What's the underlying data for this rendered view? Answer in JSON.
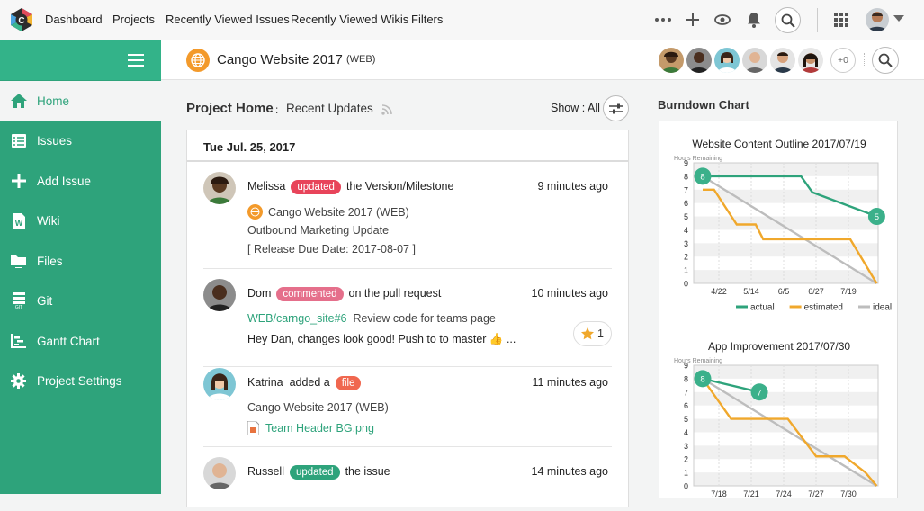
{
  "topnav": {
    "items": [
      "Dashboard",
      "Projects",
      "Recently Viewed Issues",
      "Recently Viewed Wikis",
      "Filters"
    ]
  },
  "sidebar": {
    "items": [
      {
        "label": "Home",
        "icon": "home-icon"
      },
      {
        "label": "Issues",
        "icon": "issues-icon"
      },
      {
        "label": "Add Issue",
        "icon": "plus-icon"
      },
      {
        "label": "Wiki",
        "icon": "wiki-icon"
      },
      {
        "label": "Files",
        "icon": "files-icon"
      },
      {
        "label": "Git",
        "icon": "git-icon"
      },
      {
        "label": "Gantt Chart",
        "icon": "gantt-icon"
      },
      {
        "label": "Project Settings",
        "icon": "gear-icon"
      }
    ]
  },
  "project": {
    "name": "Cango Website 2017",
    "tag": "(WEB)",
    "more_members": "+0"
  },
  "main": {
    "title": "Project Home",
    "subtitle": "Recent Updates",
    "show_label": "Show : All"
  },
  "feed": {
    "date": "Tue Jul. 25, 2017",
    "entries": [
      {
        "user": "Melissa",
        "action": "updated",
        "action_color": "#e8445a",
        "text": "the Version/Milestone",
        "time": "9 minutes ago",
        "project": "Cango Website 2017 (WEB)",
        "detail1": "Outbound Marketing Update",
        "detail2": "[ Release Due Date: 2017-08-07 ]"
      },
      {
        "user": "Dom",
        "action": "commented",
        "action_color": "#e56f8b",
        "text": "on the pull request",
        "time": "10 minutes ago",
        "link": "WEB/carngo_site#6",
        "link_text": "Review code for teams page",
        "message": "Hey Dan, changes look good! Push to to master 👍 ...",
        "likes": "1"
      },
      {
        "user": "Katrina",
        "pre": "added a",
        "action": "file",
        "action_color": "#f0674f",
        "time": "11 minutes ago",
        "project": "Cango Website 2017 (WEB)",
        "file": "Team Header BG.png"
      },
      {
        "user": "Russell",
        "action": "updated",
        "action_color": "#2ea37b",
        "text": "the issue",
        "time": "14 minutes ago"
      }
    ]
  },
  "burndown": {
    "heading": "Burndown Chart"
  },
  "chart_data": [
    {
      "type": "line",
      "title": "Website Content Outline 2017/07/19",
      "ylabel": "Hours Remaining",
      "ylim": [
        0,
        9
      ],
      "x": [
        "4/22",
        "5/14",
        "6/5",
        "6/27",
        "7/19"
      ],
      "series": [
        {
          "name": "actual",
          "color": "#2ea37b",
          "points": [
            [
              0,
              8
            ],
            [
              2.6,
              8
            ],
            [
              2.9,
              6.8
            ],
            [
              4.6,
              5
            ]
          ]
        },
        {
          "name": "estimated",
          "color": "#f0a82c",
          "points": [
            [
              0,
              7
            ],
            [
              0.3,
              7
            ],
            [
              0.9,
              4.4
            ],
            [
              1.4,
              4.4
            ],
            [
              1.6,
              3.3
            ],
            [
              3.9,
              3.3
            ],
            [
              4.6,
              0
            ]
          ]
        },
        {
          "name": "ideal",
          "color": "#bdbdbd",
          "points": [
            [
              0,
              8
            ],
            [
              4.6,
              0
            ]
          ]
        }
      ],
      "labels": [
        {
          "x": 0,
          "y": 8,
          "text": "8"
        },
        {
          "x": 4.6,
          "y": 5,
          "text": "5"
        }
      ],
      "legend": "bottom"
    },
    {
      "type": "line",
      "title": "App Improvement 2017/07/30",
      "ylabel": "Hours Remaining",
      "ylim": [
        0,
        9
      ],
      "x": [
        "7/18",
        "7/21",
        "7/24",
        "7/27",
        "7/30"
      ],
      "series": [
        {
          "name": "actual",
          "color": "#2ea37b",
          "points": [
            [
              0,
              8
            ],
            [
              1.5,
              7
            ]
          ]
        },
        {
          "name": "estimated",
          "color": "#f0a82c",
          "points": [
            [
              0,
              8
            ],
            [
              0.75,
              5
            ],
            [
              2.25,
              5
            ],
            [
              3,
              2.2
            ],
            [
              3.75,
              2.2
            ],
            [
              4.3,
              1
            ],
            [
              4.6,
              0
            ]
          ]
        },
        {
          "name": "ideal",
          "color": "#bdbdbd",
          "points": [
            [
              0,
              8
            ],
            [
              4.6,
              0
            ]
          ]
        }
      ],
      "labels": [
        {
          "x": 0,
          "y": 8,
          "text": "8"
        },
        {
          "x": 1.5,
          "y": 7,
          "text": "7"
        }
      ]
    }
  ]
}
